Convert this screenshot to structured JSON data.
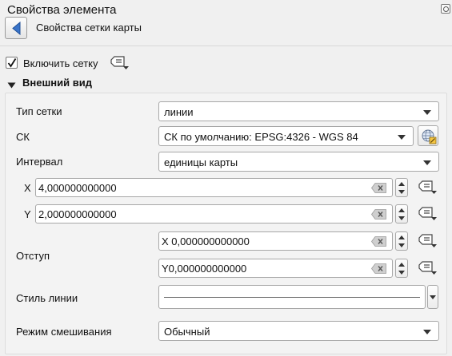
{
  "header": {
    "title": "Свойства элемента",
    "subtitle": "Свойства сетки карты"
  },
  "enable": {
    "label": "Включить сетку",
    "checked": true
  },
  "section": {
    "title": "Внешний вид",
    "expanded": true
  },
  "form": {
    "grid_type": {
      "label": "Тип сетки",
      "value": "линии"
    },
    "crs": {
      "label": "СК",
      "value": "СК по умолчанию: EPSG:4326 - WGS 84"
    },
    "interval": {
      "label": "Интервал",
      "value": "единицы карты"
    },
    "x": {
      "label": "X",
      "value": "4,000000000000"
    },
    "y": {
      "label": "Y",
      "value": "2,000000000000"
    },
    "offset": {
      "label": "Отступ",
      "x_value": "X 0,000000000000",
      "y_value": "Y0,000000000000"
    },
    "line_style": {
      "label": "Стиль линии"
    },
    "blend_mode": {
      "label": "Режим смешивания",
      "value": "Обычный"
    }
  },
  "icons": {
    "back": "back-arrow-icon",
    "data_defined": "data-defined-override-icon",
    "clear": "clear-icon",
    "crs_select": "globe-crs-icon",
    "float": "float-panel-icon"
  },
  "colors": {
    "accent_blue": "#3a74c9",
    "crs_yellow": "#f4c542"
  }
}
